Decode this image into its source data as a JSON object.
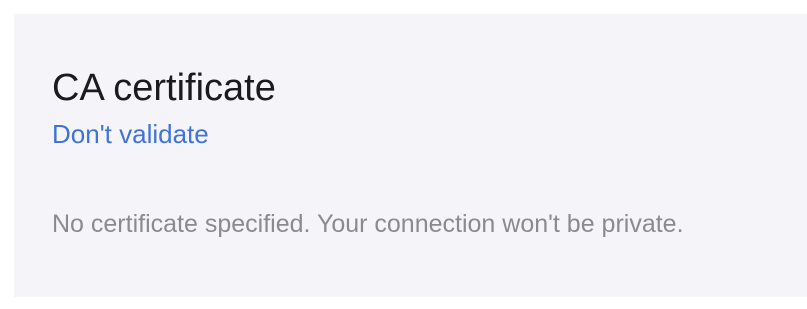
{
  "setting": {
    "title": "CA certificate",
    "value": "Don't validate",
    "warning": "No certificate specified. Your connection won't be private."
  },
  "colors": {
    "background": "#f5f5f9",
    "title": "#1b1b1f",
    "accent": "#3f73d9",
    "secondary_text": "#8a8a8f"
  }
}
